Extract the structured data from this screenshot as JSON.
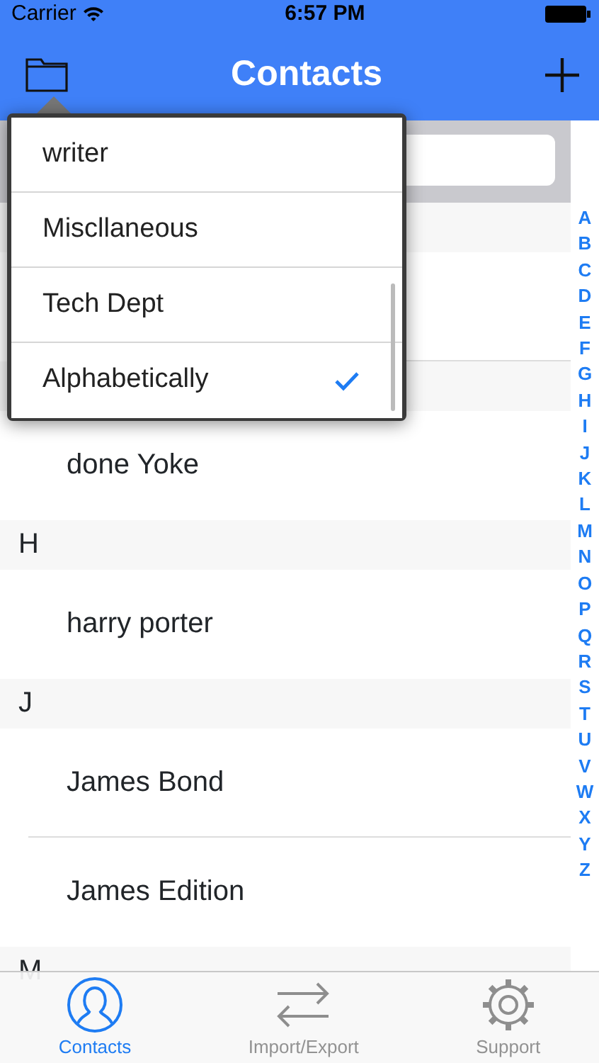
{
  "status_bar": {
    "carrier": "Carrier",
    "time": "6:57 PM"
  },
  "nav_bar": {
    "title": "Contacts"
  },
  "filter_menu": [
    {
      "label": "writer",
      "selected": false
    },
    {
      "label": "Miscllaneous",
      "selected": false
    },
    {
      "label": "Tech Dept",
      "selected": false
    },
    {
      "label": "Alphabetically",
      "selected": true
    }
  ],
  "sections": [
    {
      "header": "H",
      "rows": [
        "harry porter"
      ]
    },
    {
      "header": "J",
      "rows": [
        "James Bond",
        "James Edition"
      ]
    },
    {
      "header": "M"
    }
  ],
  "first_visible_row": "done Yoke",
  "index_letters": [
    "A",
    "B",
    "C",
    "D",
    "E",
    "F",
    "G",
    "H",
    "I",
    "J",
    "K",
    "L",
    "M",
    "N",
    "O",
    "P",
    "Q",
    "R",
    "S",
    "T",
    "U",
    "V",
    "W",
    "X",
    "Y",
    "Z"
  ],
  "tab_bar": [
    {
      "label": "Contacts",
      "kind": "person",
      "selected": true
    },
    {
      "label": "Import/Export",
      "kind": "arrows",
      "selected": false
    },
    {
      "label": "Support",
      "kind": "gear",
      "selected": false
    }
  ]
}
